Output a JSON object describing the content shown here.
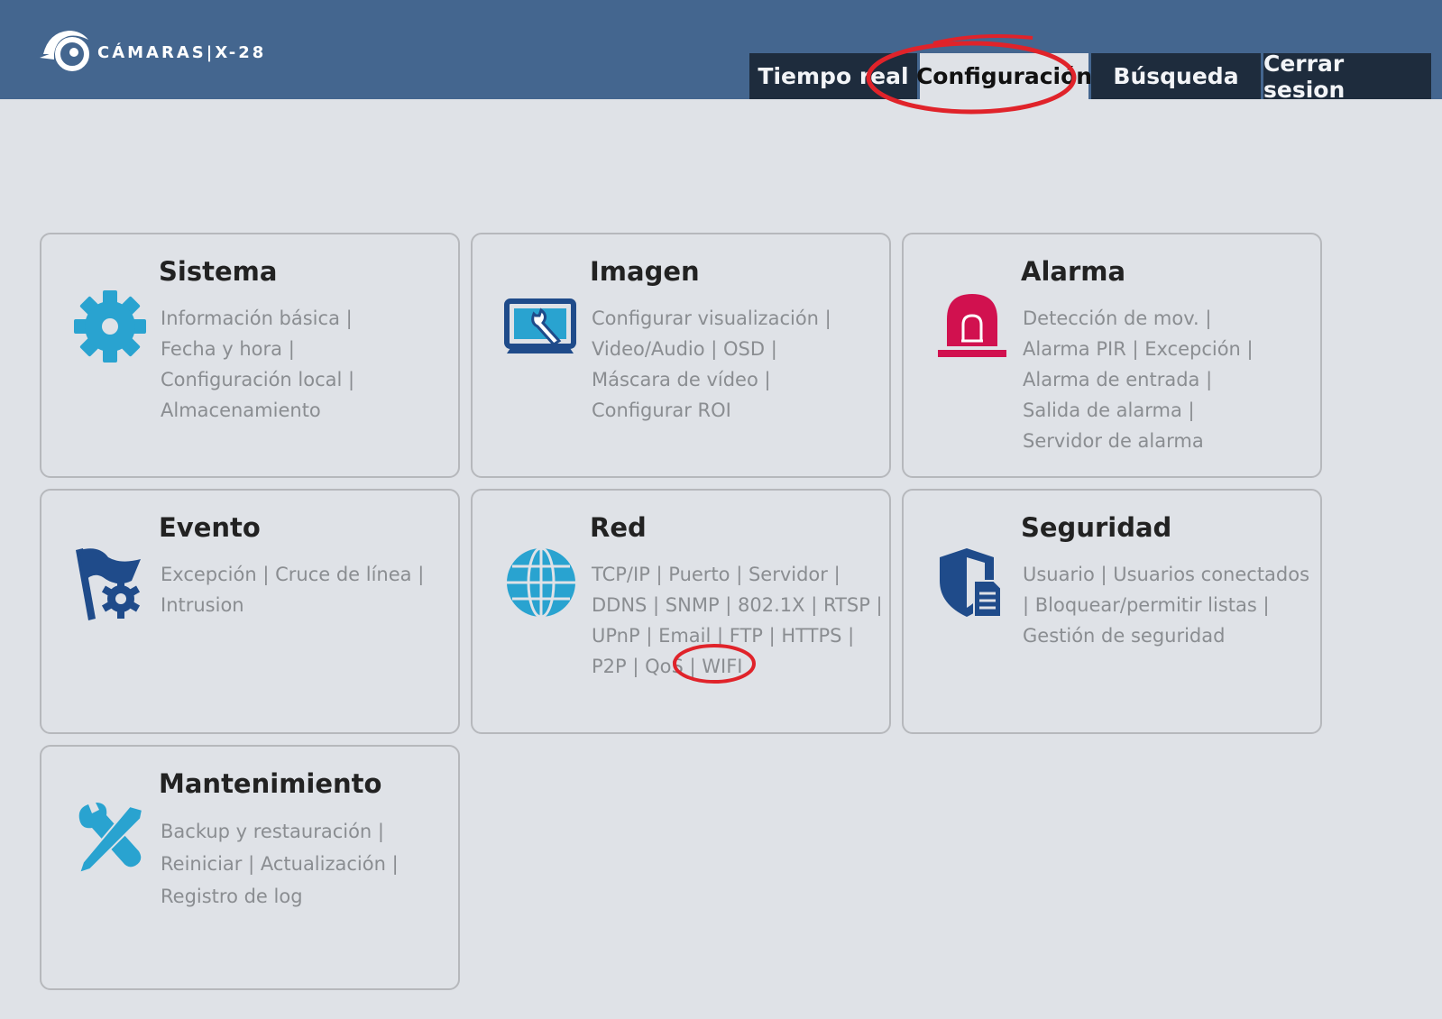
{
  "header": {
    "brand": "CÁMARAS|X-28",
    "tabs": [
      {
        "label": "Tiempo real",
        "active": false
      },
      {
        "label": "Configuración",
        "active": true
      },
      {
        "label": "Búsqueda",
        "active": false
      },
      {
        "label": "Cerrar sesion",
        "active": false
      }
    ]
  },
  "cards": [
    {
      "title": "Sistema",
      "icon": "gear-icon",
      "lines": [
        "Información básica |",
        "Fecha y hora |",
        "Configuración local |",
        "Almacenamiento"
      ]
    },
    {
      "title": "Imagen",
      "icon": "monitor-wrench-icon",
      "lines": [
        "Configurar visualización |",
        "Video/Audio | OSD |",
        "Máscara de vídeo |",
        "Configurar ROI"
      ]
    },
    {
      "title": "Alarma",
      "icon": "siren-icon",
      "lines": [
        "Detección de mov. |",
        "Alarma PIR | Excepción |",
        "Alarma de entrada |",
        "Salida de alarma |",
        "Servidor de alarma"
      ]
    },
    {
      "title": "Evento",
      "icon": "flag-gear-icon",
      "lines": [
        "Excepción | Cruce de línea |",
        "Intrusion"
      ]
    },
    {
      "title": "Red",
      "icon": "globe-icon",
      "lines": [
        "TCP/IP | Puerto | Servidor |",
        "DDNS | SNMP | 802.1X | RTSP |",
        "UPnP | Email | FTP | HTTPS |",
        "P2P | QoS | WIFI"
      ]
    },
    {
      "title": "Seguridad",
      "icon": "shield-document-icon",
      "lines": [
        "Usuario | Usuarios conectados",
        " | Bloquear/permitir listas |",
        "Gestión de seguridad"
      ]
    },
    {
      "title": "Mantenimiento",
      "icon": "tools-icon",
      "lines": [
        "Backup y restauración  |",
        "Reiniciar | Actualización |",
        "Registro de log"
      ]
    }
  ],
  "colors": {
    "header_bg": "#44668f",
    "tab_bg": "#1e2c3d",
    "page_bg": "#dfe2e7",
    "icon_blue": "#29a3d0",
    "icon_navy": "#1f4b8a",
    "alarm_red": "#d1114f",
    "annotation_red": "#e0232a"
  }
}
